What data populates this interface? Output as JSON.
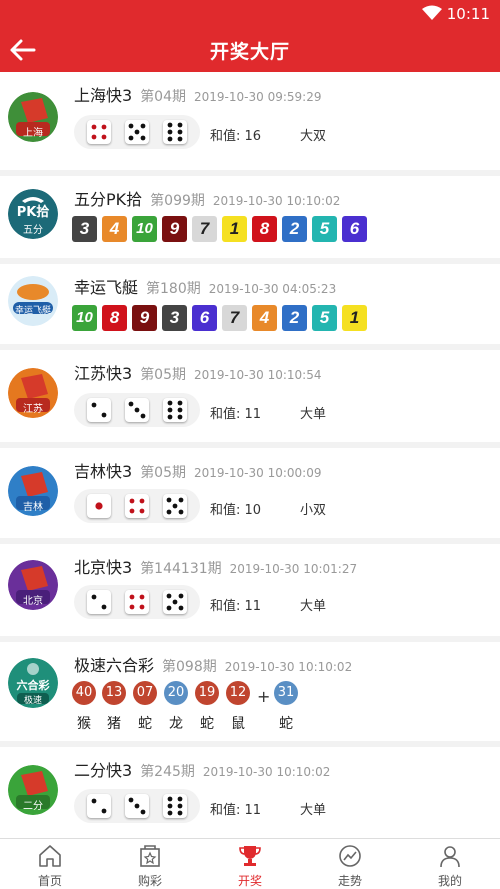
{
  "status_bar": {
    "time": "10:11"
  },
  "header": {
    "title": "开奖大厅"
  },
  "rows": [
    {
      "name": "上海快3",
      "period": "第04期",
      "time": "2019-10-30 09:59:29",
      "logo_text": "上海",
      "dice": [
        4,
        5,
        6
      ],
      "sum": "和值: 16",
      "result": "大双"
    },
    {
      "name": "五分PK拾",
      "period": "第099期",
      "time": "2019-10-30 10:10:02",
      "logo_text": "五分",
      "logo_mark": "PK拾",
      "numbers": [
        3,
        4,
        10,
        9,
        7,
        1,
        8,
        2,
        5,
        6
      ]
    },
    {
      "name": "幸运飞艇",
      "period": "第180期",
      "time": "2019-10-30 04:05:23",
      "logo_text": "幸运飞艇",
      "numbers": [
        10,
        8,
        9,
        3,
        6,
        7,
        4,
        2,
        5,
        1
      ]
    },
    {
      "name": "江苏快3",
      "period": "第05期",
      "time": "2019-10-30 10:10:54",
      "logo_text": "江苏",
      "dice": [
        2,
        3,
        6
      ],
      "sum": "和值: 11",
      "result": "大单"
    },
    {
      "name": "吉林快3",
      "period": "第05期",
      "time": "2019-10-30 10:00:09",
      "logo_text": "吉林",
      "dice": [
        1,
        4,
        5
      ],
      "sum": "和值: 10",
      "result": "小双"
    },
    {
      "name": "北京快3",
      "period": "第144131期",
      "time": "2019-10-30 10:01:27",
      "logo_text": "北京",
      "dice": [
        2,
        4,
        5
      ],
      "sum": "和值: 11",
      "result": "大单"
    },
    {
      "name": "极速六合彩",
      "period": "第098期",
      "time": "2019-10-30 10:10:02",
      "logo_text": "极速",
      "logo_mark": "六合彩",
      "balls": [
        {
          "number": "40",
          "zodiac": "猴",
          "color": "red"
        },
        {
          "number": "13",
          "zodiac": "猪",
          "color": "red"
        },
        {
          "number": "07",
          "zodiac": "蛇",
          "color": "red"
        },
        {
          "number": "20",
          "zodiac": "龙",
          "color": "blue"
        },
        {
          "number": "19",
          "zodiac": "蛇",
          "color": "red"
        },
        {
          "number": "12",
          "zodiac": "鼠",
          "color": "red"
        }
      ],
      "plus": "+",
      "special": {
        "number": "31",
        "zodiac": "蛇",
        "color": "blue"
      }
    },
    {
      "name": "二分快3",
      "period": "第245期",
      "time": "2019-10-30 10:10:02",
      "logo_text": "二分",
      "dice": [
        2,
        3,
        6
      ],
      "sum": "和值: 11",
      "result": "大单"
    }
  ],
  "nav": [
    {
      "label": "首页",
      "icon": "home-icon"
    },
    {
      "label": "购彩",
      "icon": "ticket-icon"
    },
    {
      "label": "开奖",
      "icon": "trophy-icon",
      "active": true
    },
    {
      "label": "走势",
      "icon": "trend-icon"
    },
    {
      "label": "我的",
      "icon": "user-icon"
    }
  ],
  "colors": {
    "brand_red": "#e02a2d",
    "ball_red": "#c0452f",
    "ball_blue": "#5a8fc4",
    "tiles": {
      "1": "#f5e021",
      "2": "#2f6fc6",
      "3": "#444444",
      "4": "#e8892a",
      "5": "#23b5b0",
      "6": "#4a2fd0",
      "7": "#d8d8d8",
      "8": "#d0121b",
      "9": "#7a1010",
      "10": "#3aa43a"
    }
  }
}
